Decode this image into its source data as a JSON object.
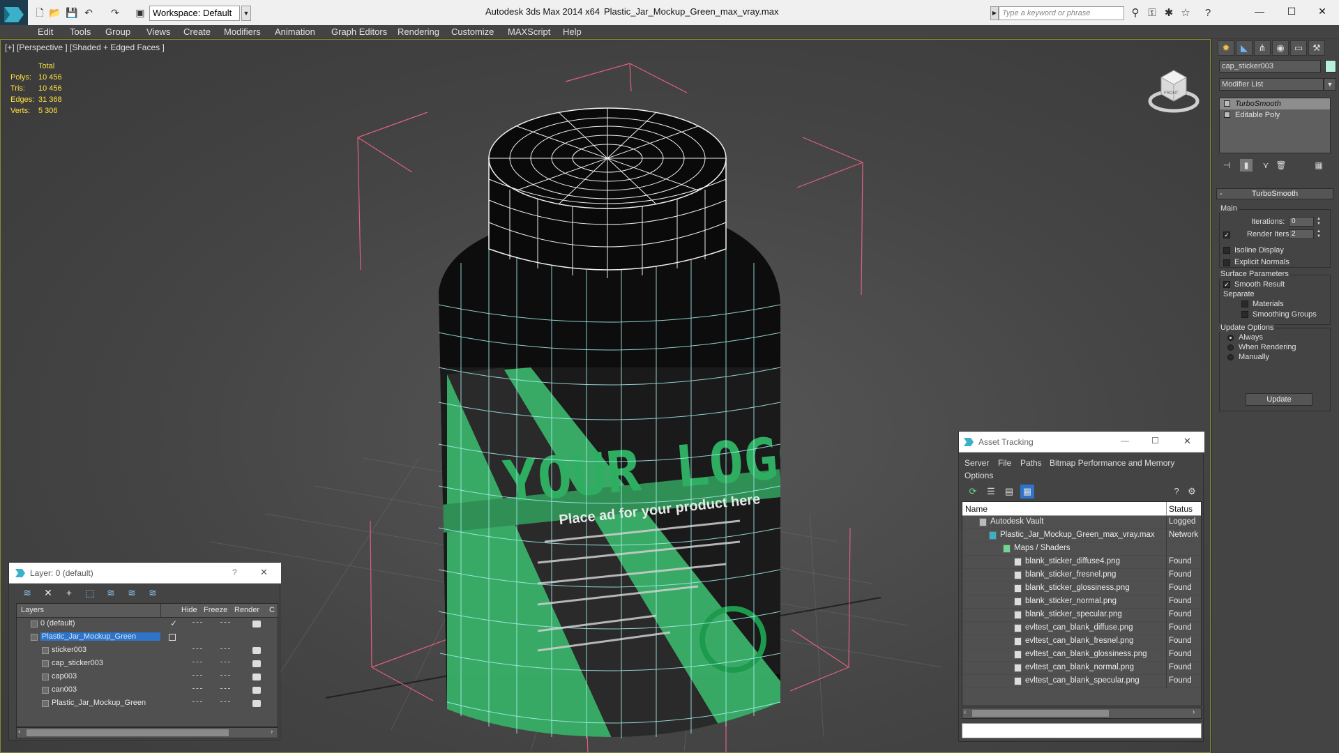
{
  "titlebar": {
    "workspace": "Workspace: Default",
    "app": "Autodesk 3ds Max  2014 x64",
    "file": "Plastic_Jar_Mockup_Green_max_vray.max",
    "search_placeholder": "Type a keyword or phrase",
    "minimize": "—",
    "maximize": "☐",
    "close": "✕"
  },
  "menu": [
    "Edit",
    "Tools",
    "Group",
    "Views",
    "Create",
    "Modifiers",
    "Animation",
    "Graph Editors",
    "Rendering",
    "Customize",
    "MAXScript",
    "Help"
  ],
  "viewport": {
    "label": "[+] [Perspective ] [Shaded + Edged Faces ]",
    "stats_title": "Total",
    "stats": [
      {
        "k": "Polys:",
        "v": "10 456"
      },
      {
        "k": "Tris:",
        "v": "10 456"
      },
      {
        "k": "Edges:",
        "v": "31 368"
      },
      {
        "k": "Verts:",
        "v": "5 306"
      }
    ],
    "label_logo": "YOUR LOGO",
    "label_sub": "Place ad for your product here",
    "viewcube_face": "FRONT"
  },
  "command_panel": {
    "object_name": "cap_sticker003",
    "modifier_list": "Modifier List",
    "stack": [
      "TurboSmooth",
      "Editable Poly"
    ],
    "rollout_title": "TurboSmooth",
    "main_group": "Main",
    "iterations_label": "Iterations:",
    "iterations_value": "0",
    "render_iters_label": "Render Iters:",
    "render_iters_value": "2",
    "isoline": "Isoline Display",
    "explicit_normals": "Explicit Normals",
    "surface_group": "Surface Parameters",
    "smooth_result": "Smooth Result",
    "separate": "Separate",
    "materials": "Materials",
    "smoothing_groups": "Smoothing Groups",
    "update_group": "Update Options",
    "always": "Always",
    "when_rendering": "When Rendering",
    "manually": "Manually",
    "update_button": "Update"
  },
  "layer_panel": {
    "title": "Layer: 0 (default)",
    "help": "?",
    "close": "✕",
    "headers": [
      "Layers",
      "Hide",
      "Freeze",
      "Render",
      "C"
    ],
    "rows": [
      {
        "name": "0 (default)"
      },
      {
        "name": "Plastic_Jar_Mockup_Green"
      },
      {
        "name": "sticker003"
      },
      {
        "name": "cap_sticker003"
      },
      {
        "name": "cap003"
      },
      {
        "name": "can003"
      },
      {
        "name": "Plastic_Jar_Mockup_Green"
      }
    ]
  },
  "asset_panel": {
    "title": "Asset Tracking",
    "minimize": "—",
    "maximize": "☐",
    "close": "✕",
    "menus": [
      "Server",
      "File",
      "Paths",
      "Bitmap Performance and Memory",
      "Options"
    ],
    "headers": [
      "Name",
      "Status"
    ],
    "rows": [
      {
        "name": "Autodesk Vault",
        "status": "Logged"
      },
      {
        "name": "Plastic_Jar_Mockup_Green_max_vray.max",
        "status": "Network"
      },
      {
        "name": "Maps / Shaders",
        "status": ""
      },
      {
        "name": "blank_sticker_diffuse4.png",
        "status": "Found"
      },
      {
        "name": "blank_sticker_fresnel.png",
        "status": "Found"
      },
      {
        "name": "blank_sticker_glossiness.png",
        "status": "Found"
      },
      {
        "name": "blank_sticker_normal.png",
        "status": "Found"
      },
      {
        "name": "blank_sticker_specular.png",
        "status": "Found"
      },
      {
        "name": "evltest_can_blank_diffuse.png",
        "status": "Found"
      },
      {
        "name": "evltest_can_blank_fresnel.png",
        "status": "Found"
      },
      {
        "name": "evltest_can_blank_glossiness.png",
        "status": "Found"
      },
      {
        "name": "evltest_can_blank_normal.png",
        "status": "Found"
      },
      {
        "name": "evltest_can_blank_specular.png",
        "status": "Found"
      }
    ]
  },
  "colors": {
    "accent": "#ffe040",
    "selection": "#2e74c8",
    "jar_green": "#3dba6e",
    "wire": "#a8f0f0"
  }
}
